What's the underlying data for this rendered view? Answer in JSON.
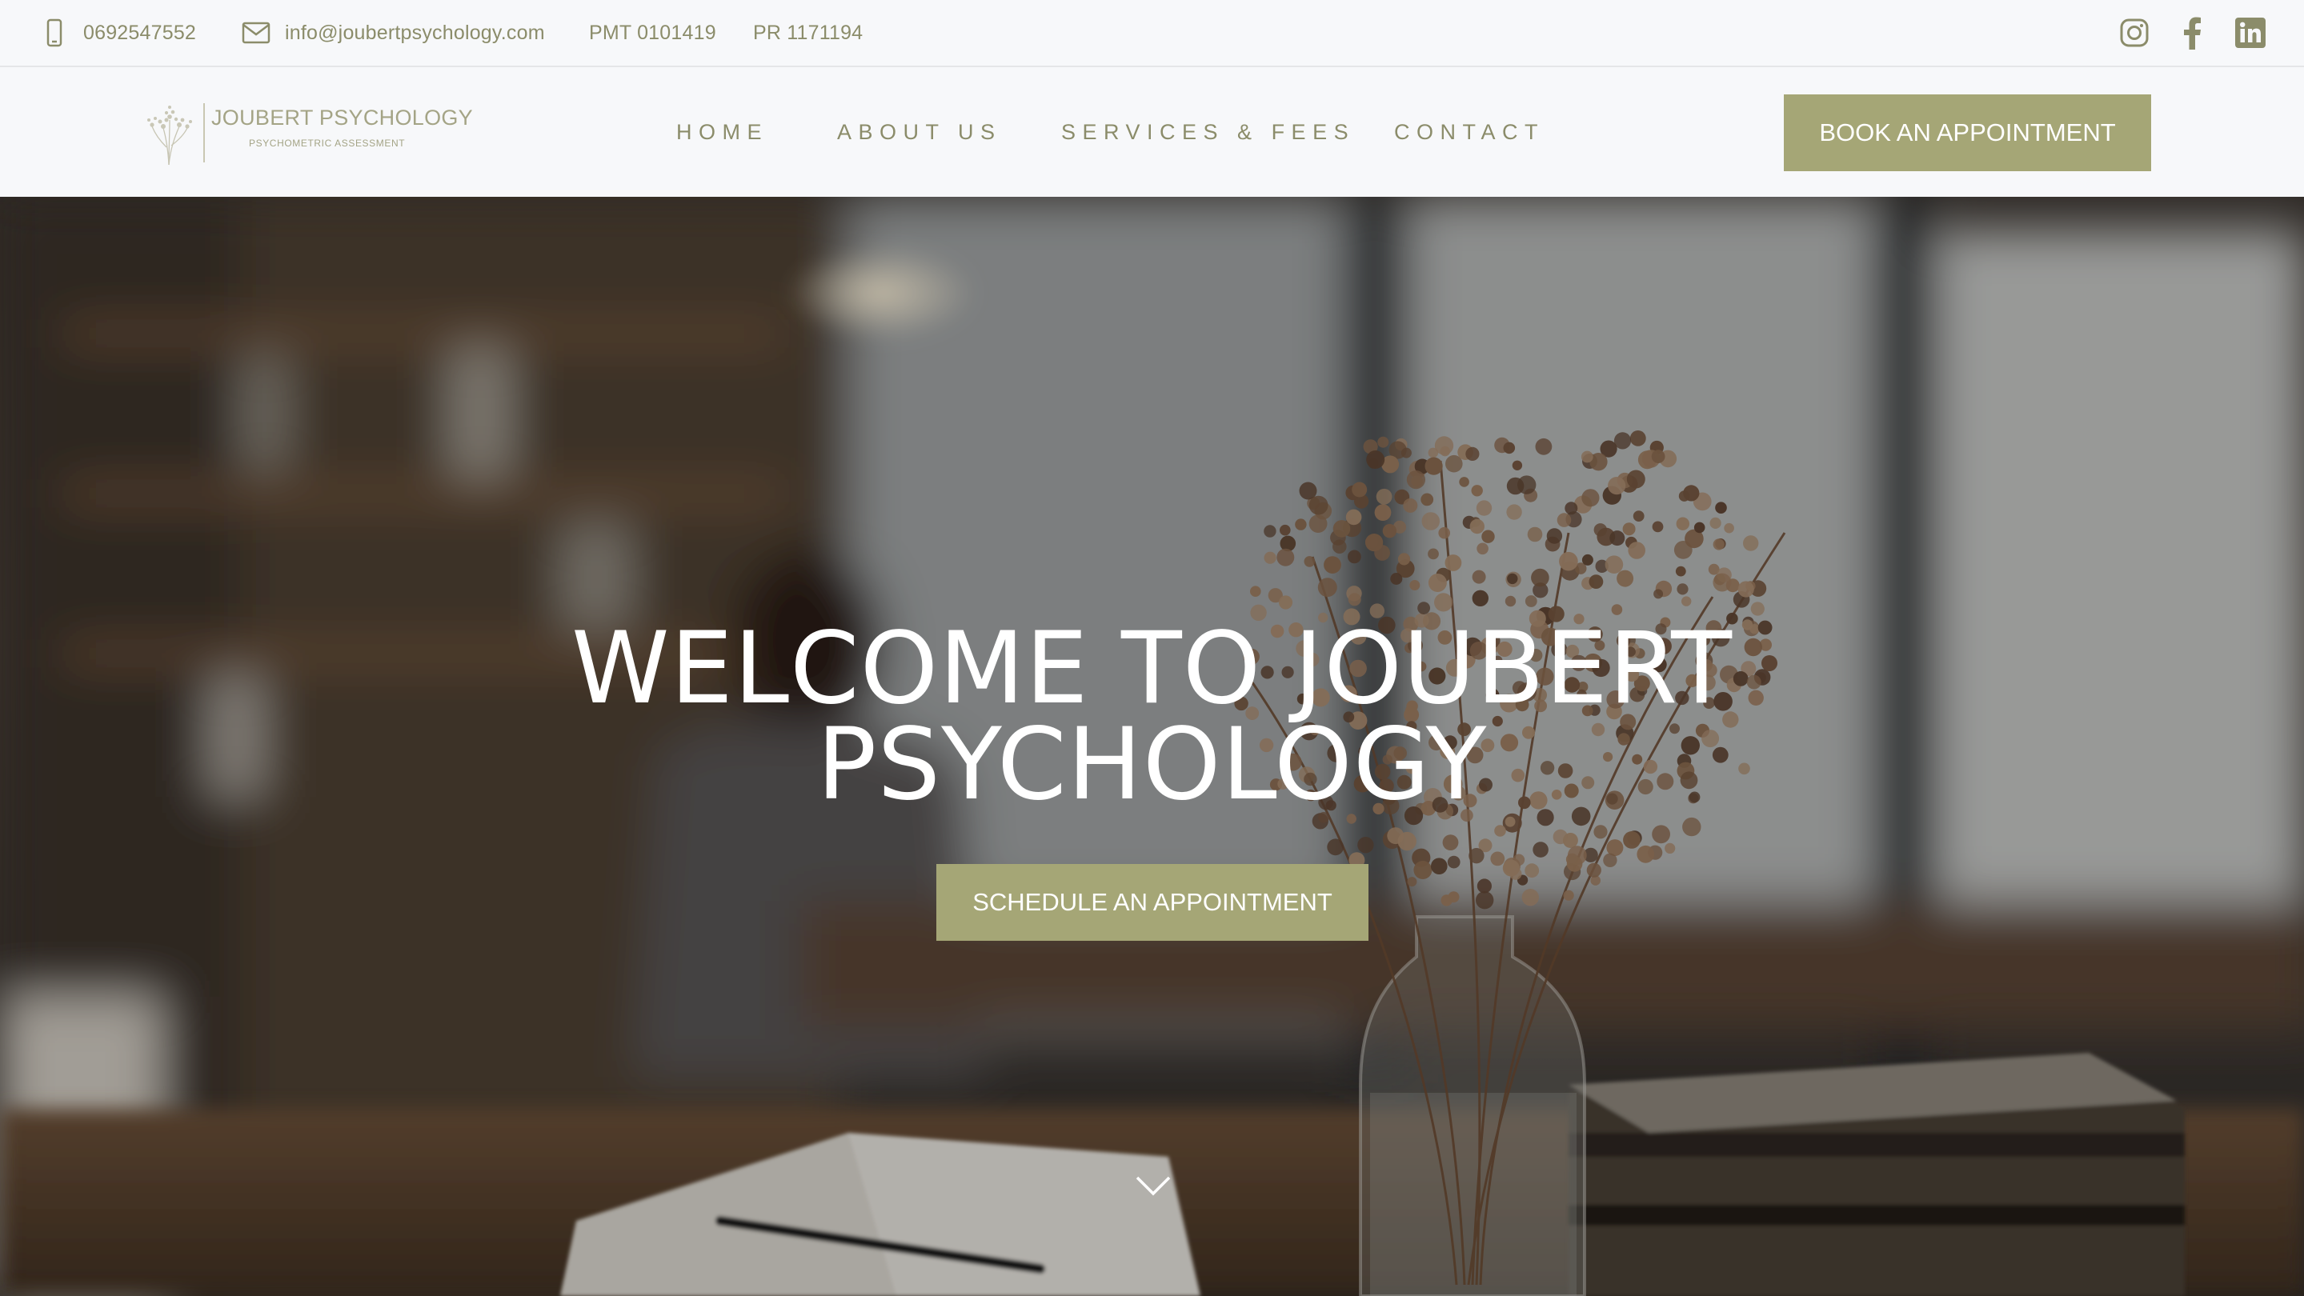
{
  "topbar": {
    "phone": "0692547552",
    "email": "info@joubertpsychology.com",
    "pmt": "PMT 0101419",
    "pr": "PR 1171194",
    "icons": [
      "phone-icon",
      "mail-icon",
      "instagram-icon",
      "facebook-icon",
      "linkedin-icon"
    ]
  },
  "logo": {
    "title": "JOUBERT PSYCHOLOGY",
    "subtitle": "PSYCHOMETRIC ASSESSMENT"
  },
  "nav": {
    "items": [
      {
        "label": "HOME"
      },
      {
        "label": "ABOUT US"
      },
      {
        "label": "SERVICES & FEES"
      },
      {
        "label": "CONTACT"
      }
    ],
    "book_label": "BOOK AN APPOINTMENT"
  },
  "hero": {
    "title_line1": "WELCOME TO JOUBERT",
    "title_line2": "PSYCHOLOGY",
    "cta_label": "SCHEDULE AN APPOINTMENT",
    "scroll_icon": "chevron-down-icon"
  },
  "colors": {
    "accent": "#a5a676",
    "text_muted": "#8b8c6a",
    "background": "#f7f8fa"
  }
}
